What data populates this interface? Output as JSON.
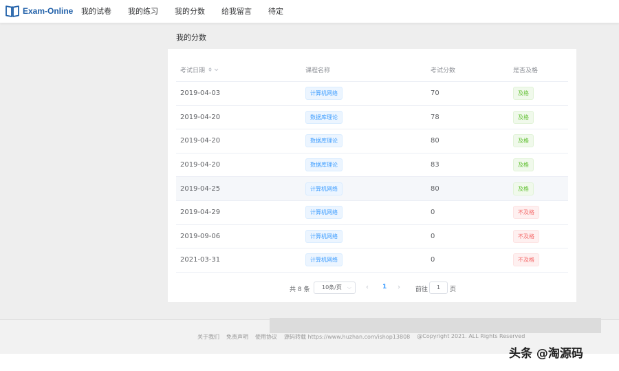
{
  "app": {
    "name": "Exam-Online",
    "nav": [
      "我的试卷",
      "我的练习",
      "我的分数",
      "给我留言",
      "待定"
    ]
  },
  "page_title": "我的分数",
  "table": {
    "headers": {
      "date": "考试日期",
      "course": "课程名称",
      "score": "考试分数",
      "pass": "是否及格"
    },
    "rows": [
      {
        "date": "2019-04-03",
        "course": "计算机网络",
        "score": "70",
        "pass": "及格",
        "passed": true
      },
      {
        "date": "2019-04-20",
        "course": "数据库理论",
        "score": "78",
        "pass": "及格",
        "passed": true
      },
      {
        "date": "2019-04-20",
        "course": "数据库理论",
        "score": "80",
        "pass": "及格",
        "passed": true
      },
      {
        "date": "2019-04-20",
        "course": "数据库理论",
        "score": "83",
        "pass": "及格",
        "passed": true
      },
      {
        "date": "2019-04-25",
        "course": "计算机网络",
        "score": "80",
        "pass": "及格",
        "passed": true
      },
      {
        "date": "2019-04-29",
        "course": "计算机网络",
        "score": "0",
        "pass": "不及格",
        "passed": false
      },
      {
        "date": "2019-09-06",
        "course": "计算机网络",
        "score": "0",
        "pass": "不及格",
        "passed": false
      },
      {
        "date": "2021-03-31",
        "course": "计算机网络",
        "score": "0",
        "pass": "不及格",
        "passed": false
      }
    ]
  },
  "pagination": {
    "total": "共 8 条",
    "page_size": "10条/页",
    "current_page": "1",
    "goto_label": "前往",
    "goto_value": "1",
    "goto_unit": "页"
  },
  "footer": {
    "links": [
      "关于我们",
      "免责声明",
      "使用协议",
      "源码转载 https://www.huzhan.com/ishop13808",
      "@Copyright 2021. ALL Rights Reserved"
    ]
  },
  "watermark": "头条 @淘源码",
  "colors": {
    "brand": "#1f5fa8",
    "primary": "#409eff",
    "success": "#67c23a",
    "danger": "#f56c6c"
  },
  "icons": {
    "logo": "open-book-icon",
    "sort": "sort-caret-icon",
    "prev": "chevron-left-icon",
    "next": "chevron-right-icon",
    "dropdown": "chevron-down-icon"
  }
}
